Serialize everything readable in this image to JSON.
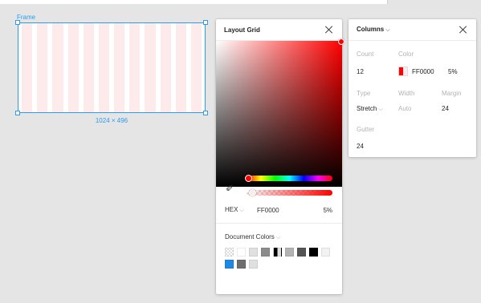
{
  "canvas": {
    "frame_label": "Frame",
    "frame_size": "1024 × 496",
    "grid_color": "#fdeaea"
  },
  "picker": {
    "title": "Layout Grid",
    "color_mode": "HEX",
    "hex_value": "FF0000",
    "alpha": "5%",
    "eyedropper_icon": "eyedropper-icon",
    "doc_colors_title": "Document Colors",
    "doc_colors": [
      "checker",
      "#ffffff",
      "#e0e0e0",
      "#8c8c8c",
      "split",
      "#b3b3b3",
      "#555555",
      "#000000",
      "#f2f2f2",
      "#1e88e5",
      "#6e6e6e",
      "#e0e0e0"
    ]
  },
  "columns": {
    "title": "Columns",
    "count_label": "Count",
    "count": "12",
    "color_label": "Color",
    "color_hex": "FF0000",
    "color_alpha": "5%",
    "type_label": "Type",
    "type": "Stretch",
    "width_label": "Width",
    "width": "Auto",
    "margin_label": "Margin",
    "margin": "24",
    "gutter_label": "Gutter",
    "gutter": "24"
  }
}
